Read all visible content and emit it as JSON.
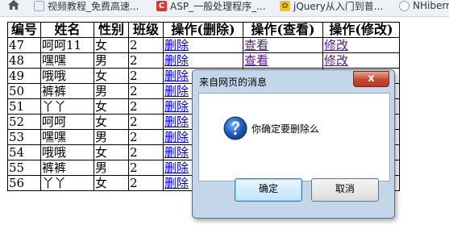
{
  "bookmarks": {
    "items": [
      {
        "label": "视频教程_免费高速..."
      },
      {
        "label": "ASP_一般处理程序_..."
      },
      {
        "label": "jQuery从入门到普..."
      },
      {
        "label": "NHibern"
      }
    ]
  },
  "table": {
    "headers": [
      "编号",
      "姓名",
      "性别",
      "班级",
      "操作(删除)",
      "操作(查看)",
      "操作(修改)"
    ],
    "rows": [
      {
        "id": "47",
        "name": "呵呵11",
        "sex": "女",
        "class": "2",
        "del": "删除",
        "view": "查看",
        "edit": "修改"
      },
      {
        "id": "48",
        "name": "嘿嘿",
        "sex": "男",
        "class": "2",
        "del": "删除",
        "view": "查看",
        "edit": "修改"
      },
      {
        "id": "49",
        "name": "哦哦",
        "sex": "女",
        "class": "2",
        "del": "删除",
        "view": "",
        "edit": ""
      },
      {
        "id": "50",
        "name": "裤裤",
        "sex": "男",
        "class": "2",
        "del": "删除",
        "view": "",
        "edit": ""
      },
      {
        "id": "51",
        "name": "丫丫",
        "sex": "女",
        "class": "2",
        "del": "删除",
        "view": "",
        "edit": ""
      },
      {
        "id": "52",
        "name": "呵呵",
        "sex": "女",
        "class": "2",
        "del": "删除",
        "view": "",
        "edit": ""
      },
      {
        "id": "53",
        "name": "嘿嘿",
        "sex": "男",
        "class": "2",
        "del": "删除",
        "view": "",
        "edit": ""
      },
      {
        "id": "54",
        "name": "哦哦",
        "sex": "女",
        "class": "2",
        "del": "删除",
        "view": "",
        "edit": ""
      },
      {
        "id": "55",
        "name": "裤裤",
        "sex": "男",
        "class": "2",
        "del": "删除",
        "view": "",
        "edit": ""
      },
      {
        "id": "56",
        "name": "丫丫",
        "sex": "女",
        "class": "2",
        "del": "删除",
        "view": "",
        "edit": ""
      }
    ]
  },
  "dialog": {
    "title": "来自网页的消息",
    "close_label": "x",
    "message": "你确定要删除么",
    "ok_label": "确定",
    "cancel_label": "取消"
  }
}
